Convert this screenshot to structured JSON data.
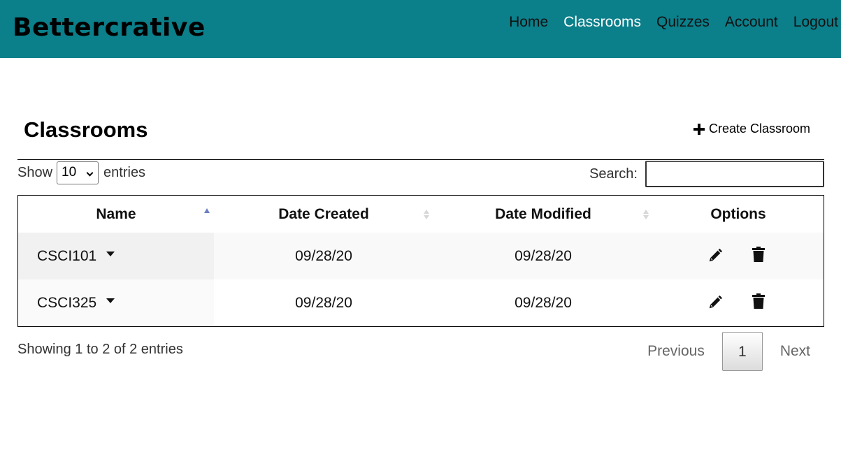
{
  "brand": "Bettercrative",
  "nav": [
    {
      "label": "Home",
      "active": false
    },
    {
      "label": "Classrooms",
      "active": true
    },
    {
      "label": "Quizzes",
      "active": false
    },
    {
      "label": "Account",
      "active": false
    },
    {
      "label": "Logout",
      "active": false
    }
  ],
  "page": {
    "title": "Classrooms",
    "create_label": "Create Classroom"
  },
  "length": {
    "prefix": "Show",
    "value": "10",
    "suffix": "entries"
  },
  "search": {
    "label": "Search:",
    "value": ""
  },
  "table": {
    "headers": [
      "Name",
      "Date Created",
      "Date Modified",
      "Options"
    ],
    "rows": [
      {
        "name": "CSCI101",
        "created": "09/28/20",
        "modified": "09/28/20"
      },
      {
        "name": "CSCI325",
        "created": "09/28/20",
        "modified": "09/28/20"
      }
    ]
  },
  "footer": {
    "info": "Showing 1 to 2 of 2 entries",
    "previous": "Previous",
    "current_page": "1",
    "next": "Next"
  },
  "colors": {
    "navbar": "#0b7f8a",
    "active_nav": "#ffffff",
    "sort_active": "#6b7fc2"
  }
}
